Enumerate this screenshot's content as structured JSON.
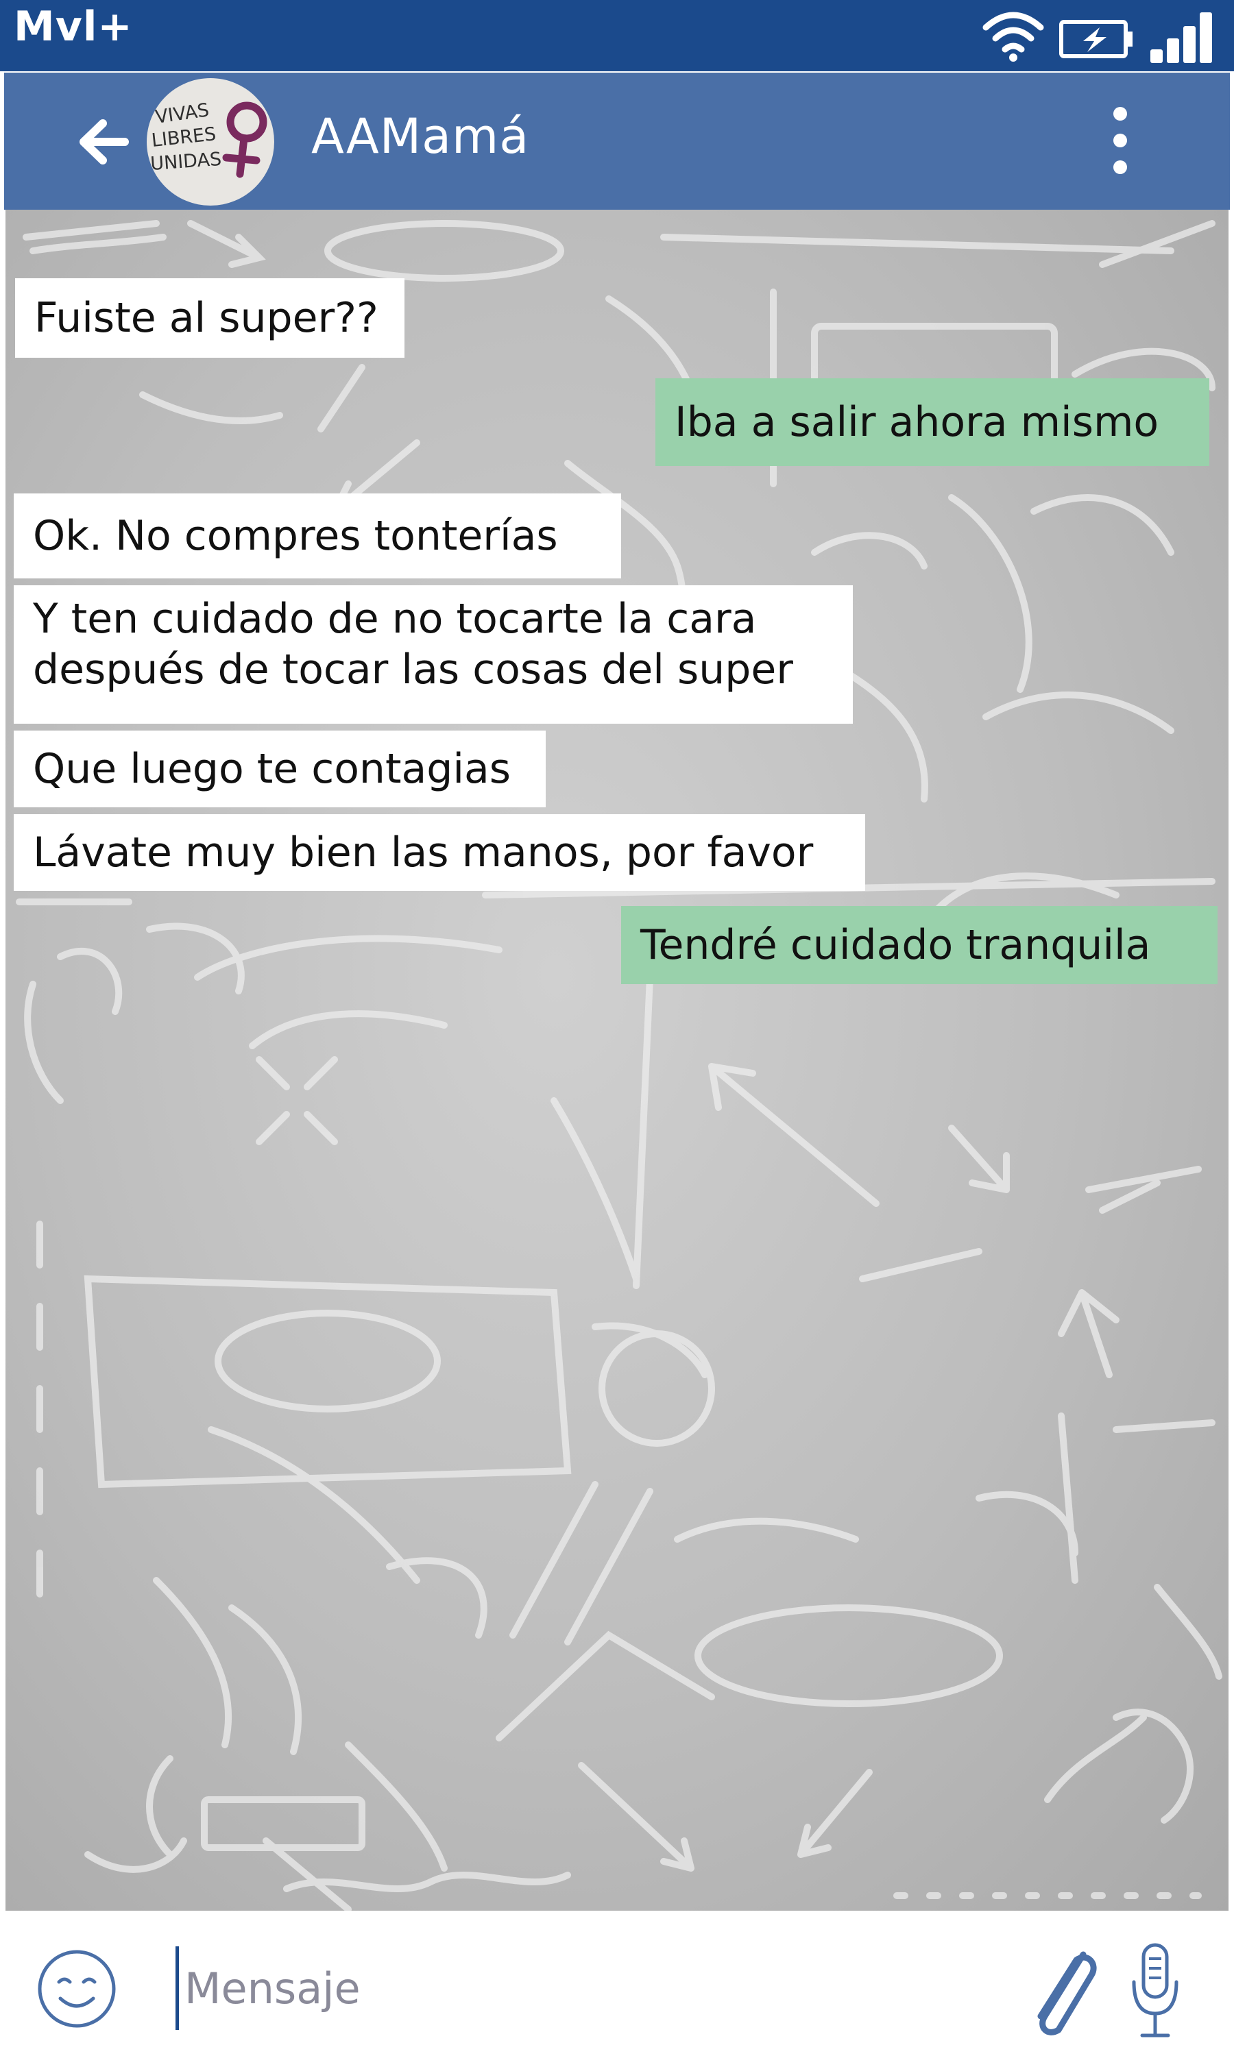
{
  "status_bar": {
    "carrier": "Mvl+",
    "icons": [
      "wifi-icon",
      "battery-charging-icon",
      "signal-icon"
    ]
  },
  "header": {
    "contact_name": "AAMamá",
    "avatar_text": [
      "VIVAS",
      "LIBRES",
      "UNIDAS"
    ],
    "icons": [
      "back-arrow-icon",
      "more-vert-icon"
    ]
  },
  "messages": [
    {
      "direction": "in",
      "text": "Fuiste al super??"
    },
    {
      "direction": "out",
      "text": "Iba a salir ahora mismo"
    },
    {
      "direction": "in",
      "text": "Ok. No compres tonterías"
    },
    {
      "direction": "in",
      "text": "Y ten cuidado de no tocarte la cara\ndespués de tocar las cosas del super"
    },
    {
      "direction": "in",
      "text": "Que luego te contagias"
    },
    {
      "direction": "in",
      "text": "Lávate muy bien las manos, por favor"
    },
    {
      "direction": "out",
      "text": "Tendré cuidado tranquila"
    }
  ],
  "input": {
    "placeholder": "Mensaje",
    "value": "",
    "icons": [
      "emoji-icon",
      "paperclip-icon",
      "microphone-icon"
    ]
  },
  "colors": {
    "status_bar": "#1b4a8c",
    "app_bar": "#4a6fa7",
    "incoming_bubble": "#ffffff",
    "outgoing_bubble": "#99d1ab",
    "avatar_symbol": "#7a2a5e",
    "input_icons": "#4a6fa7"
  }
}
